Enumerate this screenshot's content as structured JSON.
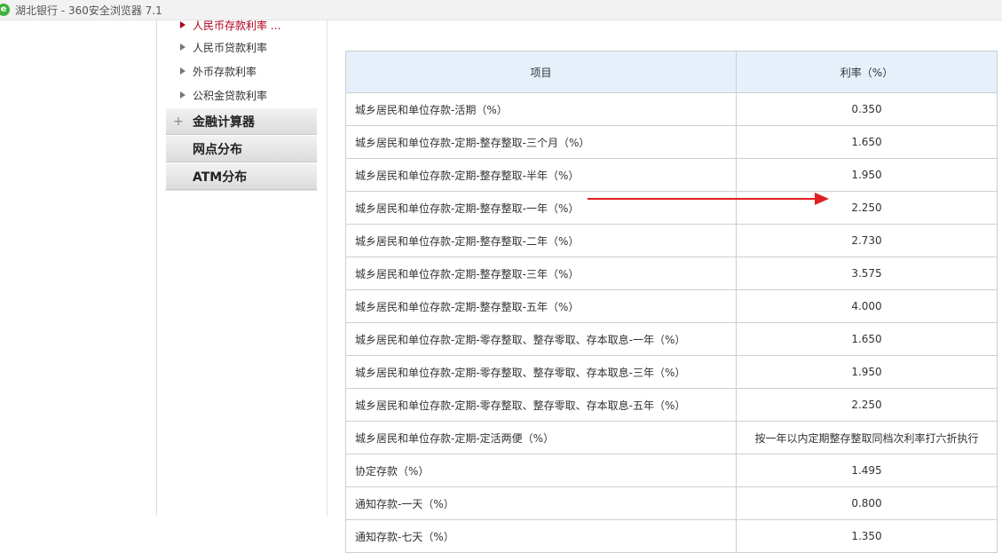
{
  "window": {
    "title": "湖北银行 - 360安全浏览器 7.1"
  },
  "sidebar": {
    "sub_items": [
      {
        "label": "人民币存款利率 ...",
        "active": true
      },
      {
        "label": "人民币贷款利率",
        "active": false
      },
      {
        "label": "外币存款利率",
        "active": false
      },
      {
        "label": "公积金贷款利率",
        "active": false
      }
    ],
    "menu": [
      {
        "label": "金融计算器",
        "expandable": true,
        "plus": "+"
      },
      {
        "label": "网点分布",
        "expandable": false
      },
      {
        "label": "ATM分布",
        "expandable": false
      }
    ]
  },
  "rate_table": {
    "headers": [
      "项目",
      "利率（%）"
    ],
    "rows": [
      [
        "城乡居民和单位存款-活期（%）",
        "0.350"
      ],
      [
        "城乡居民和单位存款-定期-整存整取-三个月（%）",
        "1.650"
      ],
      [
        "城乡居民和单位存款-定期-整存整取-半年（%）",
        "1.950"
      ],
      [
        "城乡居民和单位存款-定期-整存整取-一年（%）",
        "2.250"
      ],
      [
        "城乡居民和单位存款-定期-整存整取-二年（%）",
        "2.730"
      ],
      [
        "城乡居民和单位存款-定期-整存整取-三年（%）",
        "3.575"
      ],
      [
        "城乡居民和单位存款-定期-整存整取-五年（%）",
        "4.000"
      ],
      [
        "城乡居民和单位存款-定期-零存整取、整存零取、存本取息-一年（%）",
        "1.650"
      ],
      [
        "城乡居民和单位存款-定期-零存整取、整存零取、存本取息-三年（%）",
        "1.950"
      ],
      [
        "城乡居民和单位存款-定期-零存整取、整存零取、存本取息-五年（%）",
        "2.250"
      ],
      [
        "城乡居民和单位存款-定期-定活两便（%）",
        "按一年以内定期整存整取同档次利率打六折执行"
      ],
      [
        "协定存款（%）",
        "1.495"
      ],
      [
        "通知存款-一天（%）",
        "0.800"
      ],
      [
        "通知存款-七天（%）",
        "1.350"
      ]
    ]
  },
  "annotation": {
    "arrow_color": "#e02020"
  }
}
